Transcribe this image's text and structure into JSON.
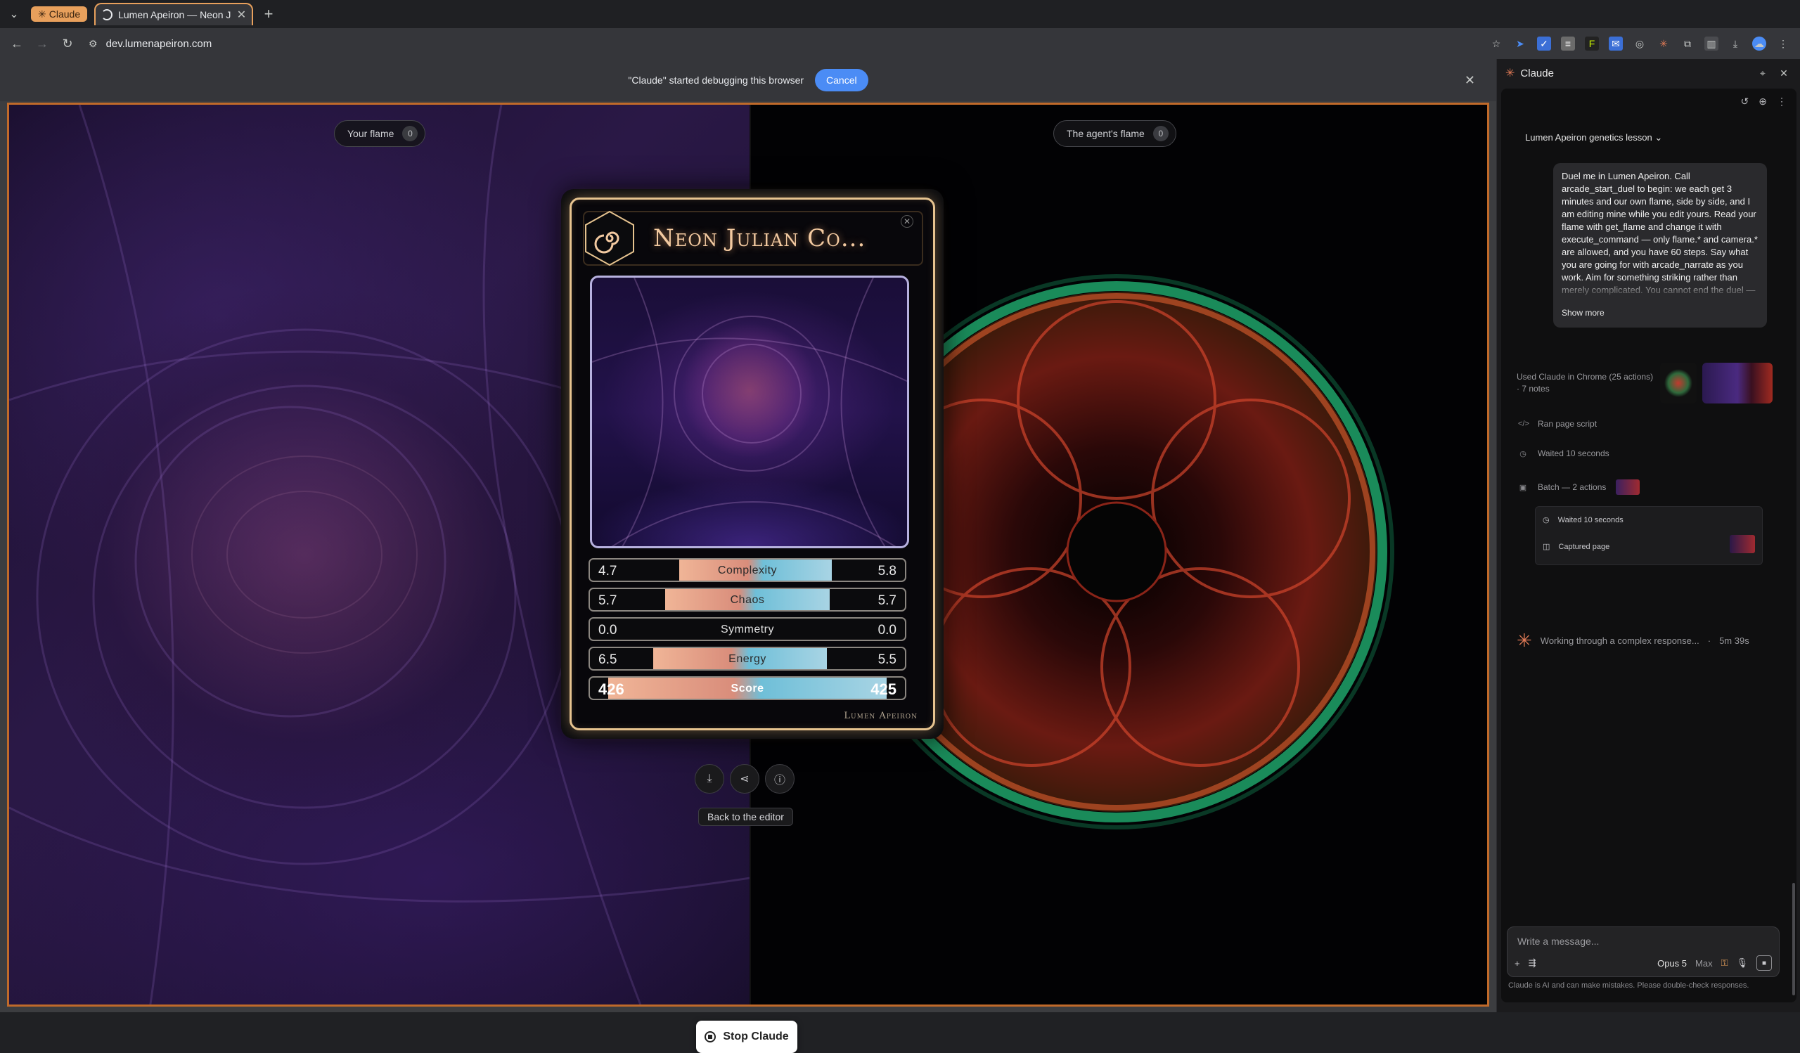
{
  "browser": {
    "tab_group_label": "Claude",
    "tab_title": "Lumen Apeiron — Neon Julian",
    "url": "dev.lumenapeiron.com"
  },
  "debug_banner": {
    "message": "\"Claude\" started debugging this browser",
    "cancel_label": "Cancel"
  },
  "duel": {
    "your_flame_label": "Your flame",
    "your_flame_count": "0",
    "agent_flame_label": "The agent's flame",
    "agent_flame_count": "0"
  },
  "card": {
    "title": "Neon Julian Co...",
    "brand": "Lumen Apeiron",
    "stats": [
      {
        "name": "Complexity",
        "left": "4.7",
        "right": "5.8",
        "left_fraction": 0.47,
        "right_fraction": 0.58
      },
      {
        "name": "Chaos",
        "left": "5.7",
        "right": "5.7",
        "left_fraction": 0.57,
        "right_fraction": 0.57
      },
      {
        "name": "Symmetry",
        "left": "0.0",
        "right": "0.0",
        "left_fraction": 0.0,
        "right_fraction": 0.0
      },
      {
        "name": "Energy",
        "left": "6.5",
        "right": "5.5",
        "left_fraction": 0.65,
        "right_fraction": 0.55
      },
      {
        "name": "Score",
        "left": "426",
        "right": "425",
        "left_fraction": 0.96,
        "right_fraction": 0.96
      }
    ],
    "back_label": "Back to the editor"
  },
  "stop_label": "Stop Claude",
  "panel": {
    "title": "Claude",
    "conversation_title": "Lumen Apeiron genetics lesson",
    "user_message": "Duel me in Lumen Apeiron. Call arcade_start_duel to begin: we each get 3 minutes and our own flame, side by side, and I am editing mine while you edit yours. Read your flame with get_flame and change it with execute_command — only flame.* and camera.* are allowed, and you have 60 steps. Say what you are going for with arcade_narrate as you work. Aim for something striking rather than merely complicated. You cannot end the duel —",
    "show_more": "Show more",
    "used_summary": "Used Claude in Chrome (25 actions) · 7 notes",
    "steps": [
      "Ran page script",
      "Waited 10 seconds",
      "Batch — 2 actions"
    ],
    "batch_steps": [
      "Waited 10 seconds",
      "Captured page"
    ],
    "working_text": "Working through a complex response...",
    "working_time": "5m 39s",
    "composer_placeholder": "Write a message...",
    "model": "Opus 5",
    "effort": "Max",
    "disclaimer": "Claude is AI and can make mistakes. Please double-check responses."
  },
  "colors": {
    "accent_orange": "#e8a05c",
    "cancel_blue": "#4b8cf5",
    "card_gold": "#e6c38f",
    "claude_spark": "#e07a56"
  }
}
